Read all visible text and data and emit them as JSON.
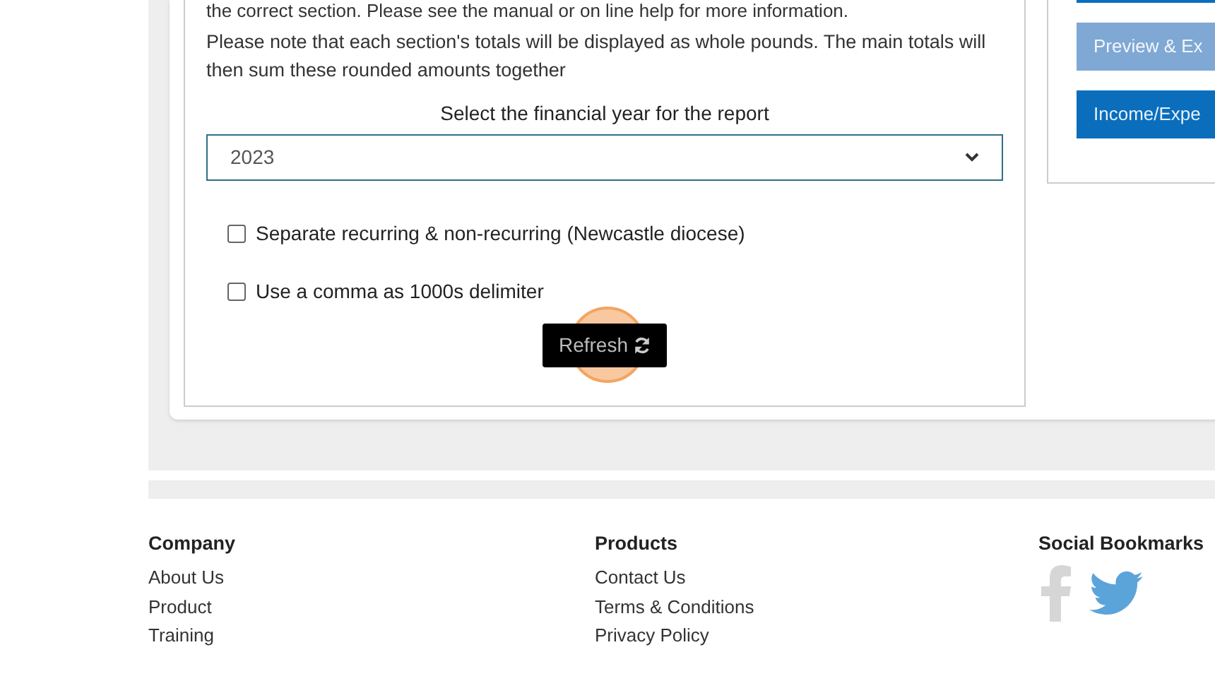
{
  "intro_text": "the correct section. Please see the manual or on line help for more information.",
  "note_text": "Please note that each section's totals will be displayed as whole pounds. The main totals will then sum these rounded amounts together",
  "year_select": {
    "label": "Select the financial year for the report",
    "value": "2023"
  },
  "options": [
    {
      "label": "Separate recurring & non-recurring (Newcastle diocese)",
      "checked": false
    },
    {
      "label": "Use a comma as 1000s delimiter",
      "checked": false
    }
  ],
  "refresh_button": {
    "label": "Refresh"
  },
  "side_buttons": [
    {
      "kind": "primary"
    },
    {
      "label": "Preview & Ex",
      "kind": "muted"
    },
    {
      "label": "Income/Expe",
      "kind": "primary"
    }
  ],
  "footer": [
    {
      "heading": "Company",
      "links": [
        "About Us",
        "Product",
        "Training"
      ]
    },
    {
      "heading": "Products",
      "links": [
        "Contact Us",
        "Terms & Conditions",
        "Privacy Policy"
      ]
    },
    {
      "heading": "Social Bookmarks"
    }
  ]
}
